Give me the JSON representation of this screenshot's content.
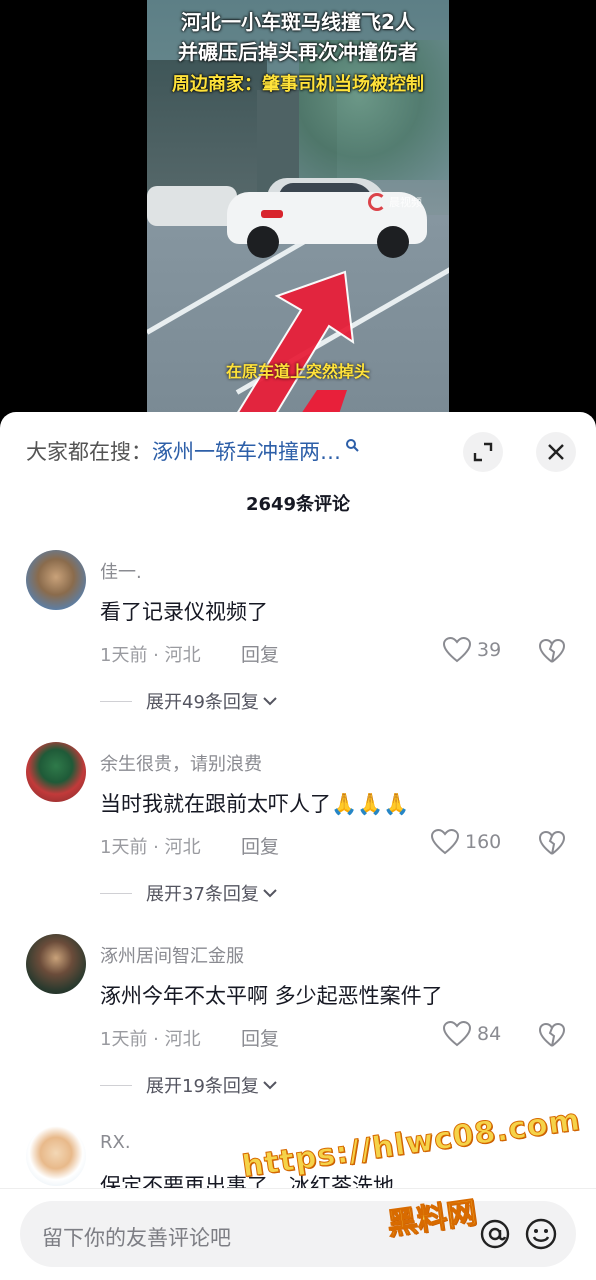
{
  "video": {
    "title_line1": "河北一小车斑马线撞飞2人",
    "title_line2": "并碾压后掉头再次冲撞伤者",
    "title_line3": "周边商家：肇事司机当场被控制",
    "subtitle": "在原车道上突然掉头",
    "watermark": "晨视频"
  },
  "search": {
    "prefix": "大家都在搜：",
    "keyword": "涿州一轿车冲撞两…"
  },
  "comments_header": {
    "count_label": "2649条评论"
  },
  "comments": [
    {
      "username": "佳一.",
      "text": "看了记录仪视频了",
      "time_location": "1天前 · 河北",
      "reply_label": "回复",
      "likes": "39",
      "expand_label": "展开49条回复"
    },
    {
      "username": "余生很贵，请别浪费",
      "text": "当时我就在跟前太吓人了🙏🙏🙏",
      "time_location": "1天前 · 河北",
      "reply_label": "回复",
      "likes": "160",
      "expand_label": "展开37条回复"
    },
    {
      "username": "涿州居间智汇金服",
      "text": "涿州今年不太平啊 多少起恶性案件了",
      "time_location": "1天前 · 河北",
      "reply_label": "回复",
      "likes": "84",
      "expand_label": "展开19条回复"
    },
    {
      "username": "RX.",
      "text": "保定不要再出事了，冰红茶洗地"
    }
  ],
  "input": {
    "placeholder": "留下你的友善评论吧"
  },
  "overlay": {
    "url": "https://hlwc08.com",
    "cn": "黑料网"
  },
  "colors": {
    "link": "#2d5fa8",
    "arrow": "#e8203a"
  }
}
